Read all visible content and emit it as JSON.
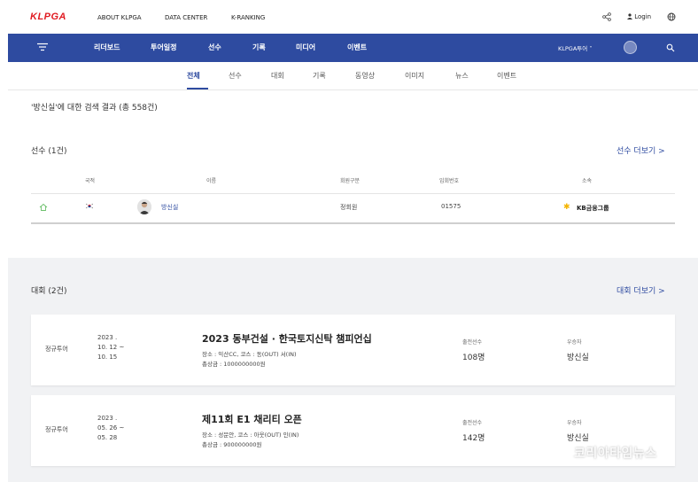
{
  "topbar": {
    "logo": "KLPGA",
    "links": [
      "ABOUT KLPGA",
      "DATA CENTER",
      "K-RANKING"
    ],
    "login": "Login",
    "share_icon": "share-icon",
    "globe_icon": "globe-icon"
  },
  "navbar": {
    "items": [
      "리더보드",
      "투어일정",
      "선수",
      "기록",
      "미디어",
      "이벤트"
    ],
    "tour_select": "KLPGA투어 ˅",
    "bg_color": "#2e4ba0"
  },
  "subtabs": {
    "items": [
      "전체",
      "선수",
      "대회",
      "기록",
      "동영상",
      "이미지",
      "뉴스",
      "이벤트"
    ],
    "active": "전체"
  },
  "result_title": "'방신실'에 대한 검색 결과 (총 558건)",
  "players": {
    "title": "선수 (1건)",
    "more": "선수 더보기 >",
    "headers": [
      "국적",
      "이름",
      "회원구분",
      "입회번호",
      "소속"
    ],
    "rows": [
      {
        "name": "방신실",
        "member_type": "정회원",
        "member_no": "01575",
        "sponsor": "KB금융그룹"
      }
    ]
  },
  "tournaments": {
    "title": "대회 (2건)",
    "more": "대회 더보기 >",
    "cards": [
      {
        "type": "정규투어",
        "date": "2023 .\n10. 12 ~\n10. 15",
        "name": "2023 동부건설 · 한국토지신탁 챔피언십",
        "place": "장소 : 익산CC, 코스 : 동(OUT) 서(IN)",
        "prize": "총상금 : 1000000000원",
        "players_label": "출전선수",
        "players_value": "108명",
        "winner_label": "우승자",
        "winner_value": "방신실"
      },
      {
        "type": "정규투어",
        "date": "2023 .\n05. 26 ~\n05. 28",
        "name": "제11회 E1 채리티 오픈",
        "place": "장소 : 성문안, 코스 : 아웃(OUT) 인(IN)",
        "prize": "총상금 : 900000000원",
        "players_label": "출전선수",
        "players_value": "142명",
        "winner_label": "우승자",
        "winner_value": "방신실"
      }
    ]
  },
  "watermark": {
    "mark": "K",
    "text": "코리아타임뉴스"
  }
}
